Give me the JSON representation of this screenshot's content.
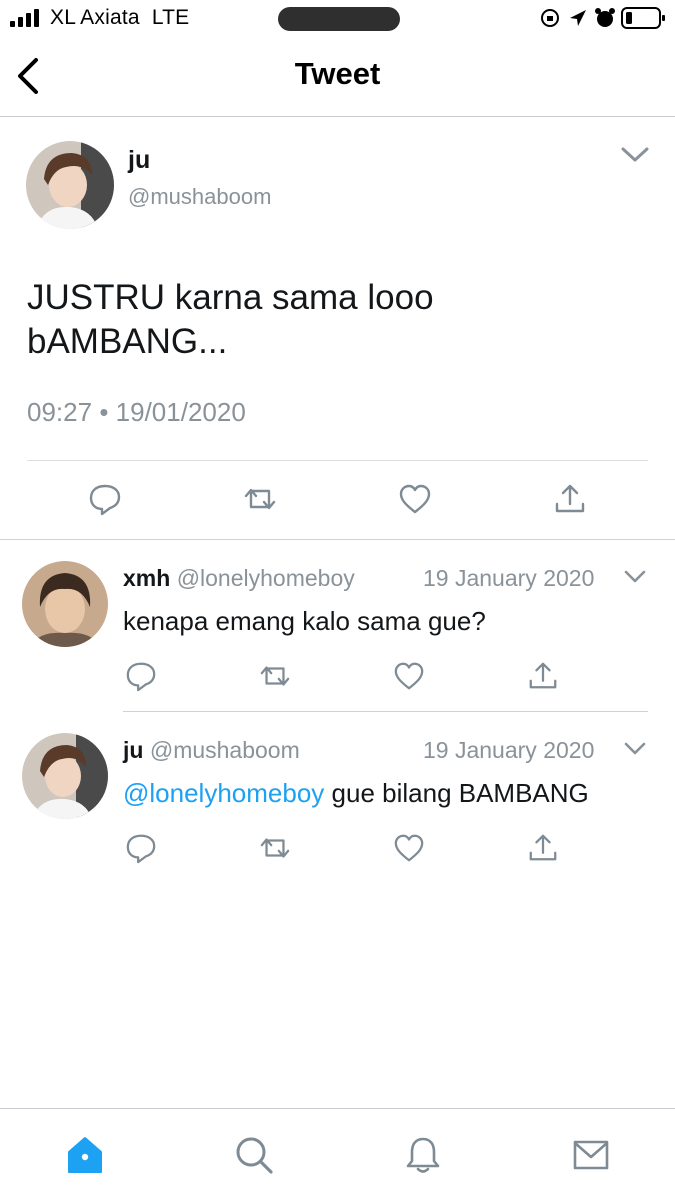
{
  "status_bar": {
    "carrier": "XL Axiata",
    "network": "LTE"
  },
  "header": {
    "title": "Tweet"
  },
  "main_tweet": {
    "name": "ju",
    "handle": "@mushaboom",
    "text_line1": "JUSTRU karna sama looo",
    "text_line2": "bAMBANG...",
    "time": "09:27",
    "separator": "•",
    "date": "19/01/2020"
  },
  "replies": [
    {
      "name": "xmh",
      "handle": "@lonelyhomeboy",
      "date": "19 January 2020",
      "text": "kenapa emang kalo sama gue?"
    },
    {
      "name": "ju",
      "handle": "@mushaboom",
      "date": "19 January 2020",
      "mention": "@lonelyhomeboy",
      "text": "gue bilang BAMBANG"
    }
  ],
  "icons": {
    "reply": "reply-icon",
    "retweet": "retweet-icon",
    "like": "heart-icon",
    "share": "share-icon",
    "home": "home-icon",
    "search": "search-icon",
    "notifications": "bell-icon",
    "messages": "mail-icon"
  },
  "colors": {
    "accent": "#1da1f2",
    "muted": "#8a9299",
    "icon": "#7f8b94",
    "text": "#14171a"
  }
}
